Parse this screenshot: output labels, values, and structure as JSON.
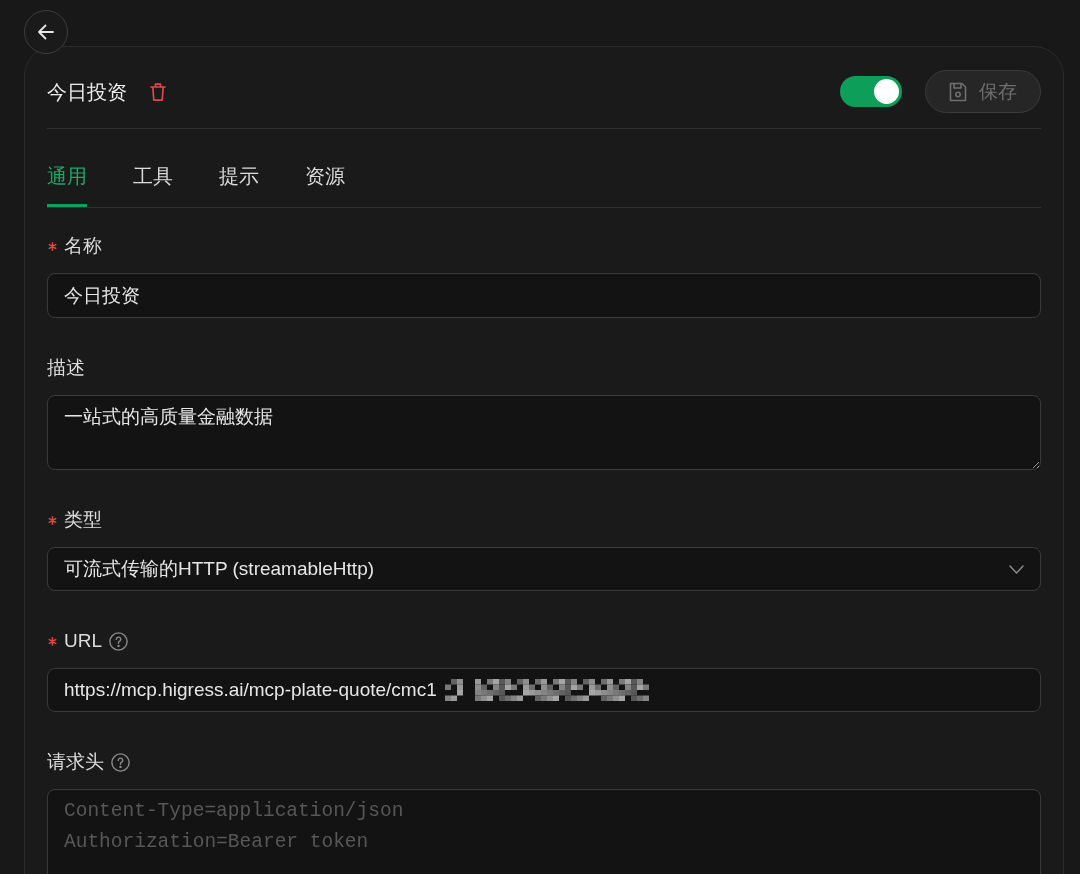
{
  "header": {
    "title": "今日投资",
    "enabled": true,
    "save_button": {
      "label": "保存",
      "disabled": true
    }
  },
  "tabs": [
    {
      "label": "通用",
      "selected": true
    },
    {
      "label": "工具",
      "selected": false
    },
    {
      "label": "提示",
      "selected": false
    },
    {
      "label": "资源",
      "selected": false
    }
  ],
  "fields": [
    {
      "kind": "input",
      "label": "名称",
      "required": true,
      "help": false,
      "value": "今日投资"
    },
    {
      "kind": "textarea",
      "label": "描述",
      "required": false,
      "help": false,
      "value": "一站式的高质量金融数据"
    },
    {
      "kind": "select",
      "label": "类型",
      "required": true,
      "help": false,
      "value": "可流式传输的HTTP (streamableHttp)"
    },
    {
      "kind": "input",
      "label": "URL",
      "required": true,
      "help": true,
      "redacted": true,
      "value": "https://mcp.higress.ai/mcp-plate-quote/cmc1"
    },
    {
      "kind": "code",
      "label": "请求头",
      "required": false,
      "help": true,
      "placeholder": "Content-Type=application/json\nAuthorization=Bearer token"
    }
  ]
}
